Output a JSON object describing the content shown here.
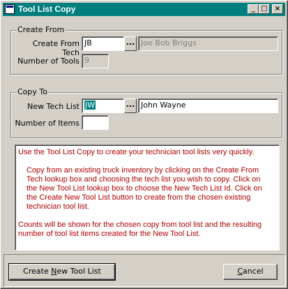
{
  "window": {
    "title": "Tool List Copy"
  },
  "create_from": {
    "group_label": "Create From",
    "tech_label": "Create From Tech",
    "tech_code": "JB",
    "tech_name": "Joe Bob Briggs",
    "tools_label": "Number of Tools",
    "tools_count": "9"
  },
  "copy_to": {
    "group_label": "Copy To",
    "list_label": "New Tech List",
    "list_code": "JW",
    "list_name": "John Wayne",
    "items_label": "Number of Items",
    "items_count": ""
  },
  "memo": {
    "para1": "Use the Tool List Copy to create your technician tool lists very quickly.",
    "para2": "Copy from an existing truck inventory by clicking on the Create From Tech lookup box and choosing the tech list you wish to copy.  Click on the New Tool List lookup box to choose the New Tech List Id.  Click on the Create New Tool List button to create from the chosen existing technician tool list.",
    "para3": "Counts will be shown for the chosen copy from tool list and the resulting number of tool list items created for the New Tool List."
  },
  "buttons": {
    "create_pre": "Create ",
    "create_mn": "N",
    "create_post": "ew Tool List",
    "cancel_mn": "C",
    "cancel_post": "ancel"
  },
  "glyphs": {
    "lookup": "...",
    "minimize": "_",
    "maximize": "□",
    "close": "×"
  },
  "colors": {
    "title_bar": "#007e7e",
    "memo_text": "#b00000",
    "selection": "#007e7e"
  }
}
